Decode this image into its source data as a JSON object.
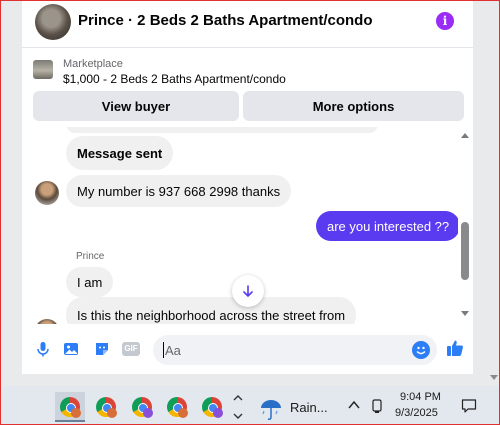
{
  "header": {
    "title": "Prince · 2 Beds 2 Baths Apartment/condo",
    "info_icon": "info-icon",
    "info_glyph": "i",
    "accent_color": "#9b2cf5"
  },
  "marketplace": {
    "label": "Marketplace",
    "listing": "$1,000 - 2 Beds 2 Baths Apartment/condo",
    "view_buyer_label": "View buyer",
    "more_options_label": "More options"
  },
  "messages": [
    {
      "type": "system",
      "text": "Message sent"
    },
    {
      "type": "incoming",
      "text": "My number is 937 668 2998 thanks"
    },
    {
      "type": "outgoing",
      "text": "are you interested ??"
    },
    {
      "type": "sender",
      "text": "Prince"
    },
    {
      "type": "incoming",
      "text": "I am"
    },
    {
      "type": "incoming",
      "text": "Is this the neighborhood across the street from"
    }
  ],
  "colors": {
    "outgoing_bubble": "#5a3bf0",
    "incoming_bubble": "#f0f0f0",
    "emoji_blue": "#2d7df6"
  },
  "composer": {
    "placeholder": "Aa",
    "gif_label": "GIF"
  },
  "taskbar": {
    "weather_label": "Rain...",
    "time": "9:04 PM",
    "date": "9/3/2025"
  }
}
